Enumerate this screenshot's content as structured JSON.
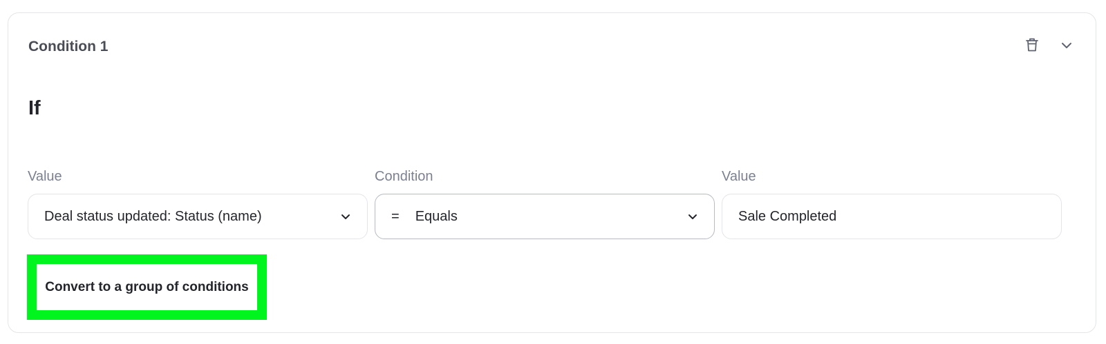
{
  "condition": {
    "title": "Condition 1",
    "if_label": "If",
    "actions": {
      "delete_icon": "trash-icon",
      "collapse_icon": "chevron-down-icon"
    }
  },
  "fields": {
    "left": {
      "label": "Value",
      "value": "Deal status updated: Status (name)"
    },
    "operator": {
      "label": "Condition",
      "symbol": "=",
      "value": "Equals"
    },
    "right": {
      "label": "Value",
      "value": "Sale Completed"
    }
  },
  "convert_button": {
    "label": "Convert to a group of conditions"
  },
  "colors": {
    "highlight": "#00f51f",
    "border": "#e3e5e9",
    "label": "#7c8190",
    "text": "#23252b"
  }
}
